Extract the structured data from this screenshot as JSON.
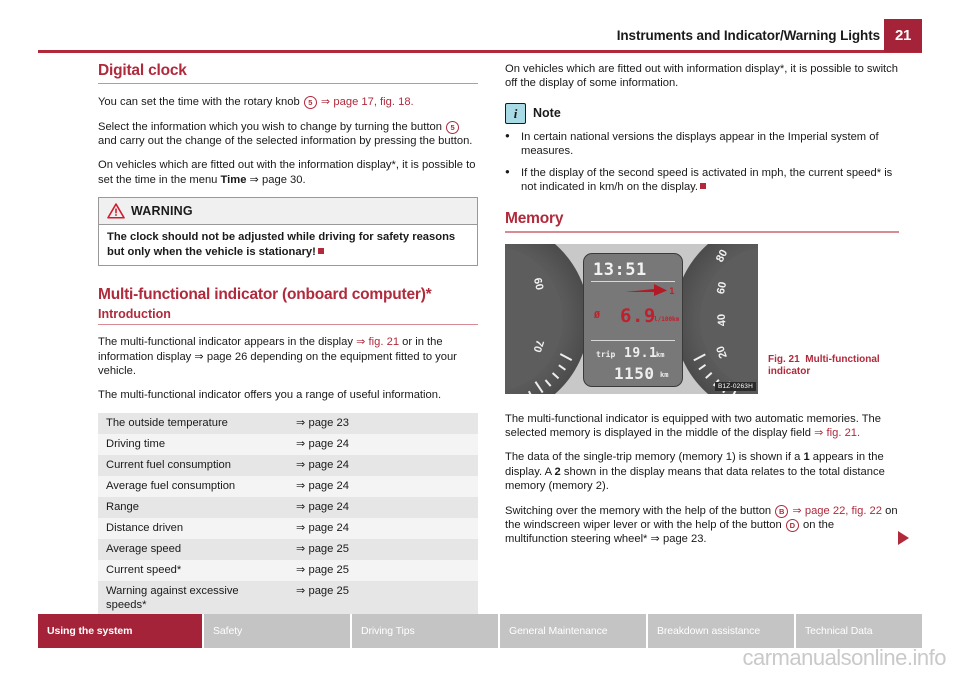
{
  "header": {
    "title": "Instruments and Indicator/Warning Lights",
    "page_number": "21",
    "accent_color": "#a42338"
  },
  "left_column": {
    "section_digital_clock": {
      "heading": "Digital clock",
      "para_1_pre": "You can set the time with the rotary knob ",
      "para_1_callout": "5",
      "para_1_post": " ⇒ page 17, fig. 18.",
      "para_2_pre": "Select the information which you wish to change by turning the button ",
      "para_2_callout": "5",
      "para_2_post": " and carry out the change of the selected information by pressing the button.",
      "para_3_pre": "On vehicles which are fitted out with the information display*, it is possible to set the time in the menu ",
      "para_3_bold": "Time",
      "para_3_post": " ⇒ page 30."
    },
    "warning_box": {
      "icon": "warning-triangle-icon",
      "label": "WARNING",
      "text": "The clock should not be adjusted while driving for safety reasons but only when the vehicle is stationary!"
    },
    "section_mfi": {
      "heading": "Multi‐functional indicator (onboard computer)*",
      "subheading": "Introduction",
      "para_1_pre": "The multi-functional indicator appears in the display ",
      "para_1_ref": "⇒ fig. 21",
      "para_1_post": " or in the information display ⇒ page 26 depending on the equipment fitted to your vehicle.",
      "para_2": "The multi-functional indicator offers you a range of useful information."
    },
    "info_table": {
      "rows": [
        {
          "label": "The outside temperature",
          "ref": "⇒ page 23"
        },
        {
          "label": "Driving time",
          "ref": "⇒ page 24"
        },
        {
          "label": "Current fuel consumption",
          "ref": "⇒ page 24"
        },
        {
          "label": "Average fuel consumption",
          "ref": "⇒ page 24"
        },
        {
          "label": "Range",
          "ref": "⇒ page 24"
        },
        {
          "label": "Distance driven",
          "ref": "⇒ page 24"
        },
        {
          "label": "Average speed",
          "ref": "⇒ page 25"
        },
        {
          "label": "Current speed*",
          "ref": "⇒ page 25"
        },
        {
          "label": "Warning against excessive speeds*",
          "ref": "⇒ page 25"
        }
      ]
    }
  },
  "right_column": {
    "intro_para": "On vehicles which are fitted out with information display*, it is possible to switch off the display of some information.",
    "note_box": {
      "icon": "info-icon",
      "icon_glyph": "i",
      "label": "Note",
      "bullets": [
        "In certain national versions the displays appear in the Imperial system of measures.",
        "If the display of the second speed is activated in mph, the current speed* is not indicated in km/h on the display."
      ]
    },
    "section_memory": {
      "heading": "Memory",
      "para_1_pre": "The multi-functional indicator is equipped with two automatic memories. The selected memory is displayed in the middle of the display field ",
      "para_1_ref": "⇒ fig. 21.",
      "para_2_a": "The data of the single-trip memory (memory 1) is shown if a ",
      "para_2_b1": "1",
      "para_2_c": " appears in the display. A ",
      "para_2_b2": "2",
      "para_2_d": " shown in the display means that data relates to the total distance memory (memory 2).",
      "para_3_a": "Switching over the memory with the help of the button ",
      "para_3_callout_b": "B",
      "para_3_ref": " ⇒ page 22, fig. 22",
      "para_3_b": " on the windscreen wiper lever or with the help of the button ",
      "para_3_callout_d": "D",
      "para_3_c": " on the multifunction steering wheel* ⇒ page 23."
    },
    "figure": {
      "caption_number": "Fig. 21",
      "caption_text": "Multi‐functional indicator",
      "image_code": "B1Z-0263H",
      "lcd": {
        "time": "13:51",
        "memory_indicator": "1",
        "avg_symbol": "Ø",
        "consumption": "6.9",
        "consumption_unit": "l/100km",
        "trip_label": "trip",
        "trip_value": "19.1",
        "trip_unit": "km",
        "total_value": "1150",
        "total_unit": "km"
      },
      "gauge_left_numbers": [
        "60",
        "70"
      ],
      "gauge_right_numbers": [
        "80",
        "60",
        "40",
        "20"
      ]
    }
  },
  "footer": {
    "tabs": [
      {
        "label": "Using the system",
        "active": true
      },
      {
        "label": "Safety",
        "active": false
      },
      {
        "label": "Driving Tips",
        "active": false
      },
      {
        "label": "General Maintenance",
        "active": false
      },
      {
        "label": "Breakdown assistance",
        "active": false
      },
      {
        "label": "Technical Data",
        "active": false
      }
    ],
    "watermark": "carmanualsonline.info"
  }
}
